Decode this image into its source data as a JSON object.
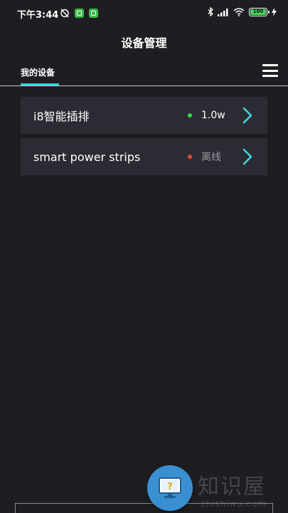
{
  "status_bar": {
    "time": "下午3:44",
    "battery": "100"
  },
  "header": {
    "title": "设备管理"
  },
  "tabs": {
    "my_devices": "我的设备"
  },
  "devices": [
    {
      "name": "i8智能插排",
      "status": "1.0w",
      "status_color": "#37d84a"
    },
    {
      "name": "smart power strips",
      "status": "离线",
      "status_color": "#e84a2f"
    }
  ],
  "watermark": {
    "text": "知识屋",
    "sub": "zhishiwu.com"
  },
  "colors": {
    "background": "#1e1e22",
    "row_background": "#2b2c33",
    "accent": "#2fd0d6",
    "chevron": "#45d4df"
  }
}
